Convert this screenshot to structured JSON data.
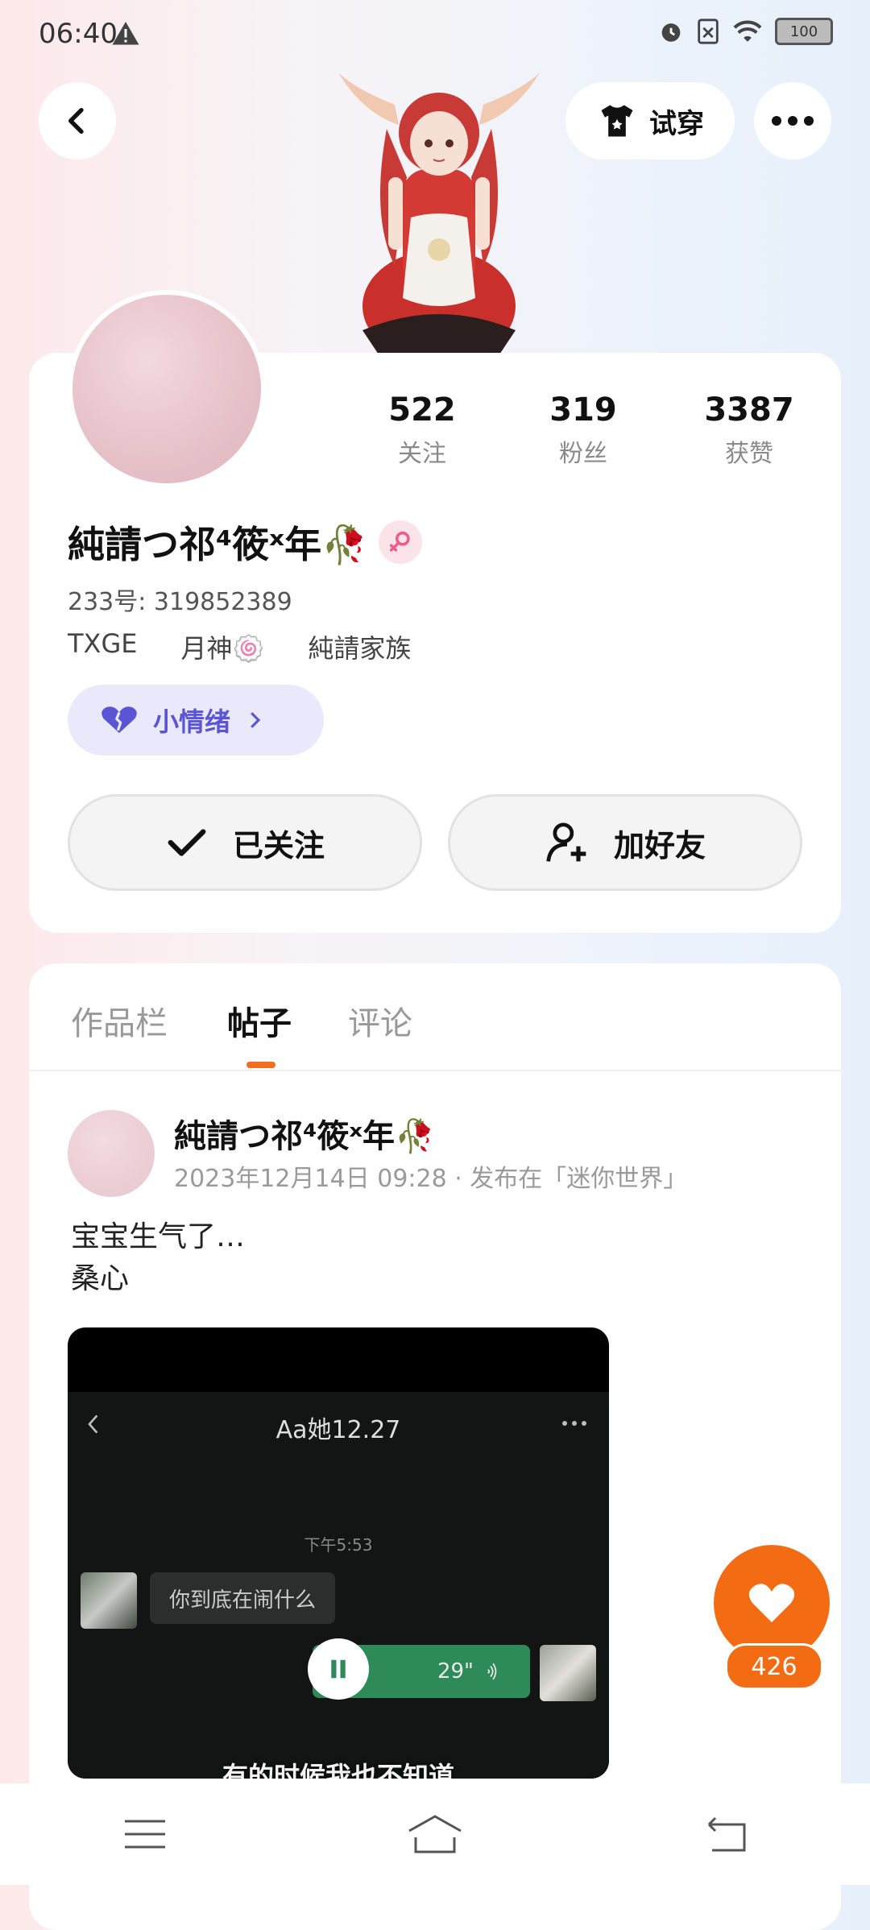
{
  "status_bar": {
    "time": "06:40",
    "battery": "100"
  },
  "header": {
    "try_on_label": "试穿"
  },
  "stats": [
    {
      "num": "522",
      "label": "关注"
    },
    {
      "num": "319",
      "label": "粉丝"
    },
    {
      "num": "3387",
      "label": "获赞"
    }
  ],
  "profile": {
    "username": "純請つ祁⁴筱ˣ年🥀",
    "uid": "233号: 319852389",
    "tags": [
      "TXGE",
      "月神🍥",
      "純請家族"
    ],
    "mood_label": "小情绪"
  },
  "actions": {
    "followed_label": "已关注",
    "add_friend_label": "加好友"
  },
  "tabs": [
    "作品栏",
    "帖子",
    "评论"
  ],
  "post": {
    "author": "純請つ祁⁴筱ˣ年🥀",
    "meta": "2023年12月14日 09:28 · 发布在「迷你世界」",
    "line1": "宝宝生气了…",
    "line2": "桑心",
    "video": {
      "chat_title": "Aa她12.27",
      "chat_time": "下午5:53",
      "bubble_text": "你到底在闹什么",
      "voice_duration": "29\"",
      "subtitle": "有的时候我也不知道"
    }
  },
  "likes": {
    "count": "426"
  },
  "colors": {
    "accent": "#f36c14",
    "mood": "#5b55d6"
  }
}
